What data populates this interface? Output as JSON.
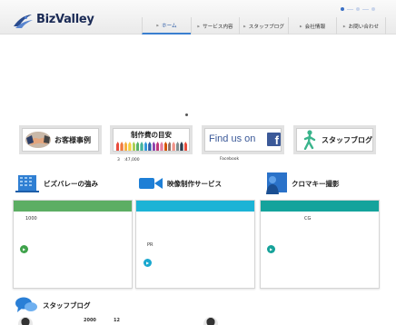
{
  "logo": {
    "text": "BizValley"
  },
  "nav": [
    {
      "label": "ホーム",
      "active": true
    },
    {
      "label": "サービス内容",
      "active": false
    },
    {
      "label": "スタッフブログ",
      "active": false
    },
    {
      "label": "会社情報",
      "active": false
    },
    {
      "label": "お問い合わせ",
      "active": false
    }
  ],
  "banners": {
    "cases": "お客様事例",
    "price": "制作費の目安",
    "facebook": "Find us on",
    "facebook_mark": "f",
    "blog": "スタッフブログ"
  },
  "captions": {
    "price": "3　:47,000",
    "facebook": "Facebook"
  },
  "sections": [
    {
      "title": "ビズバレーの強み",
      "text": "1000"
    },
    {
      "title": "映像制作サービス",
      "text": "PR"
    },
    {
      "title": "クロマキー撮影",
      "text": "CG"
    }
  ],
  "blog": {
    "title": "スタッフブログ",
    "num_a": "2000",
    "num_b": "12"
  },
  "colors": {
    "card1": "#5cae63",
    "card2": "#1bb3d6",
    "card3": "#14a39c",
    "nav_active": "#3a7fd0",
    "facebook": "#3b5998"
  }
}
